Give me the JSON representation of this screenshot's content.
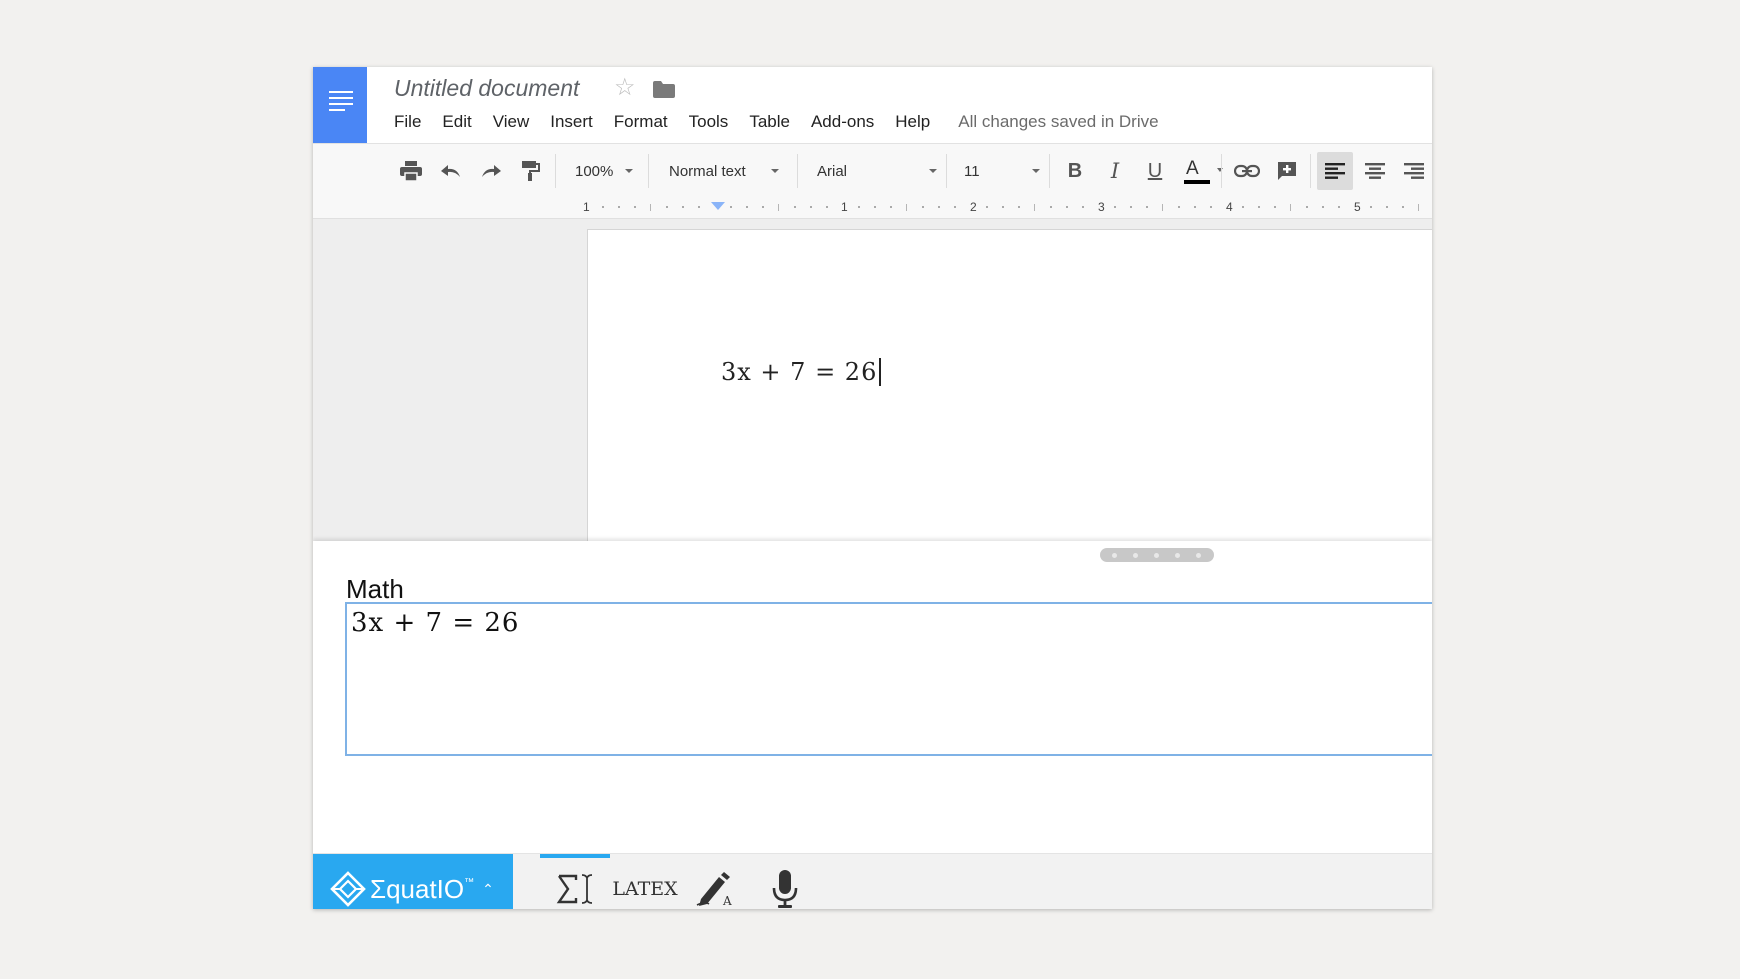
{
  "header": {
    "doc_title": "Untitled document",
    "menu": [
      "File",
      "Edit",
      "View",
      "Insert",
      "Format",
      "Tools",
      "Table",
      "Add-ons",
      "Help"
    ],
    "save_status": "All changes saved in Drive"
  },
  "toolbar": {
    "zoom": "100%",
    "style": "Normal text",
    "font": "Arial",
    "size": "11",
    "bold": "B",
    "italic": "I",
    "underline": "U",
    "text_color": "A"
  },
  "ruler": {
    "numbers": [
      "1",
      "1",
      "2",
      "3",
      "4",
      "5"
    ]
  },
  "document": {
    "equation": "3x + 7 = 26"
  },
  "math_panel": {
    "title": "Math",
    "input_value": "3x + 7 = 26"
  },
  "equatio": {
    "brand": "ΣquatIO",
    "trademark": "™",
    "latex_label": "LATEX",
    "accent_color": "#29a8f0"
  },
  "colors": {
    "docs_blue": "#4a86f5",
    "input_border": "#7fb2e6"
  }
}
